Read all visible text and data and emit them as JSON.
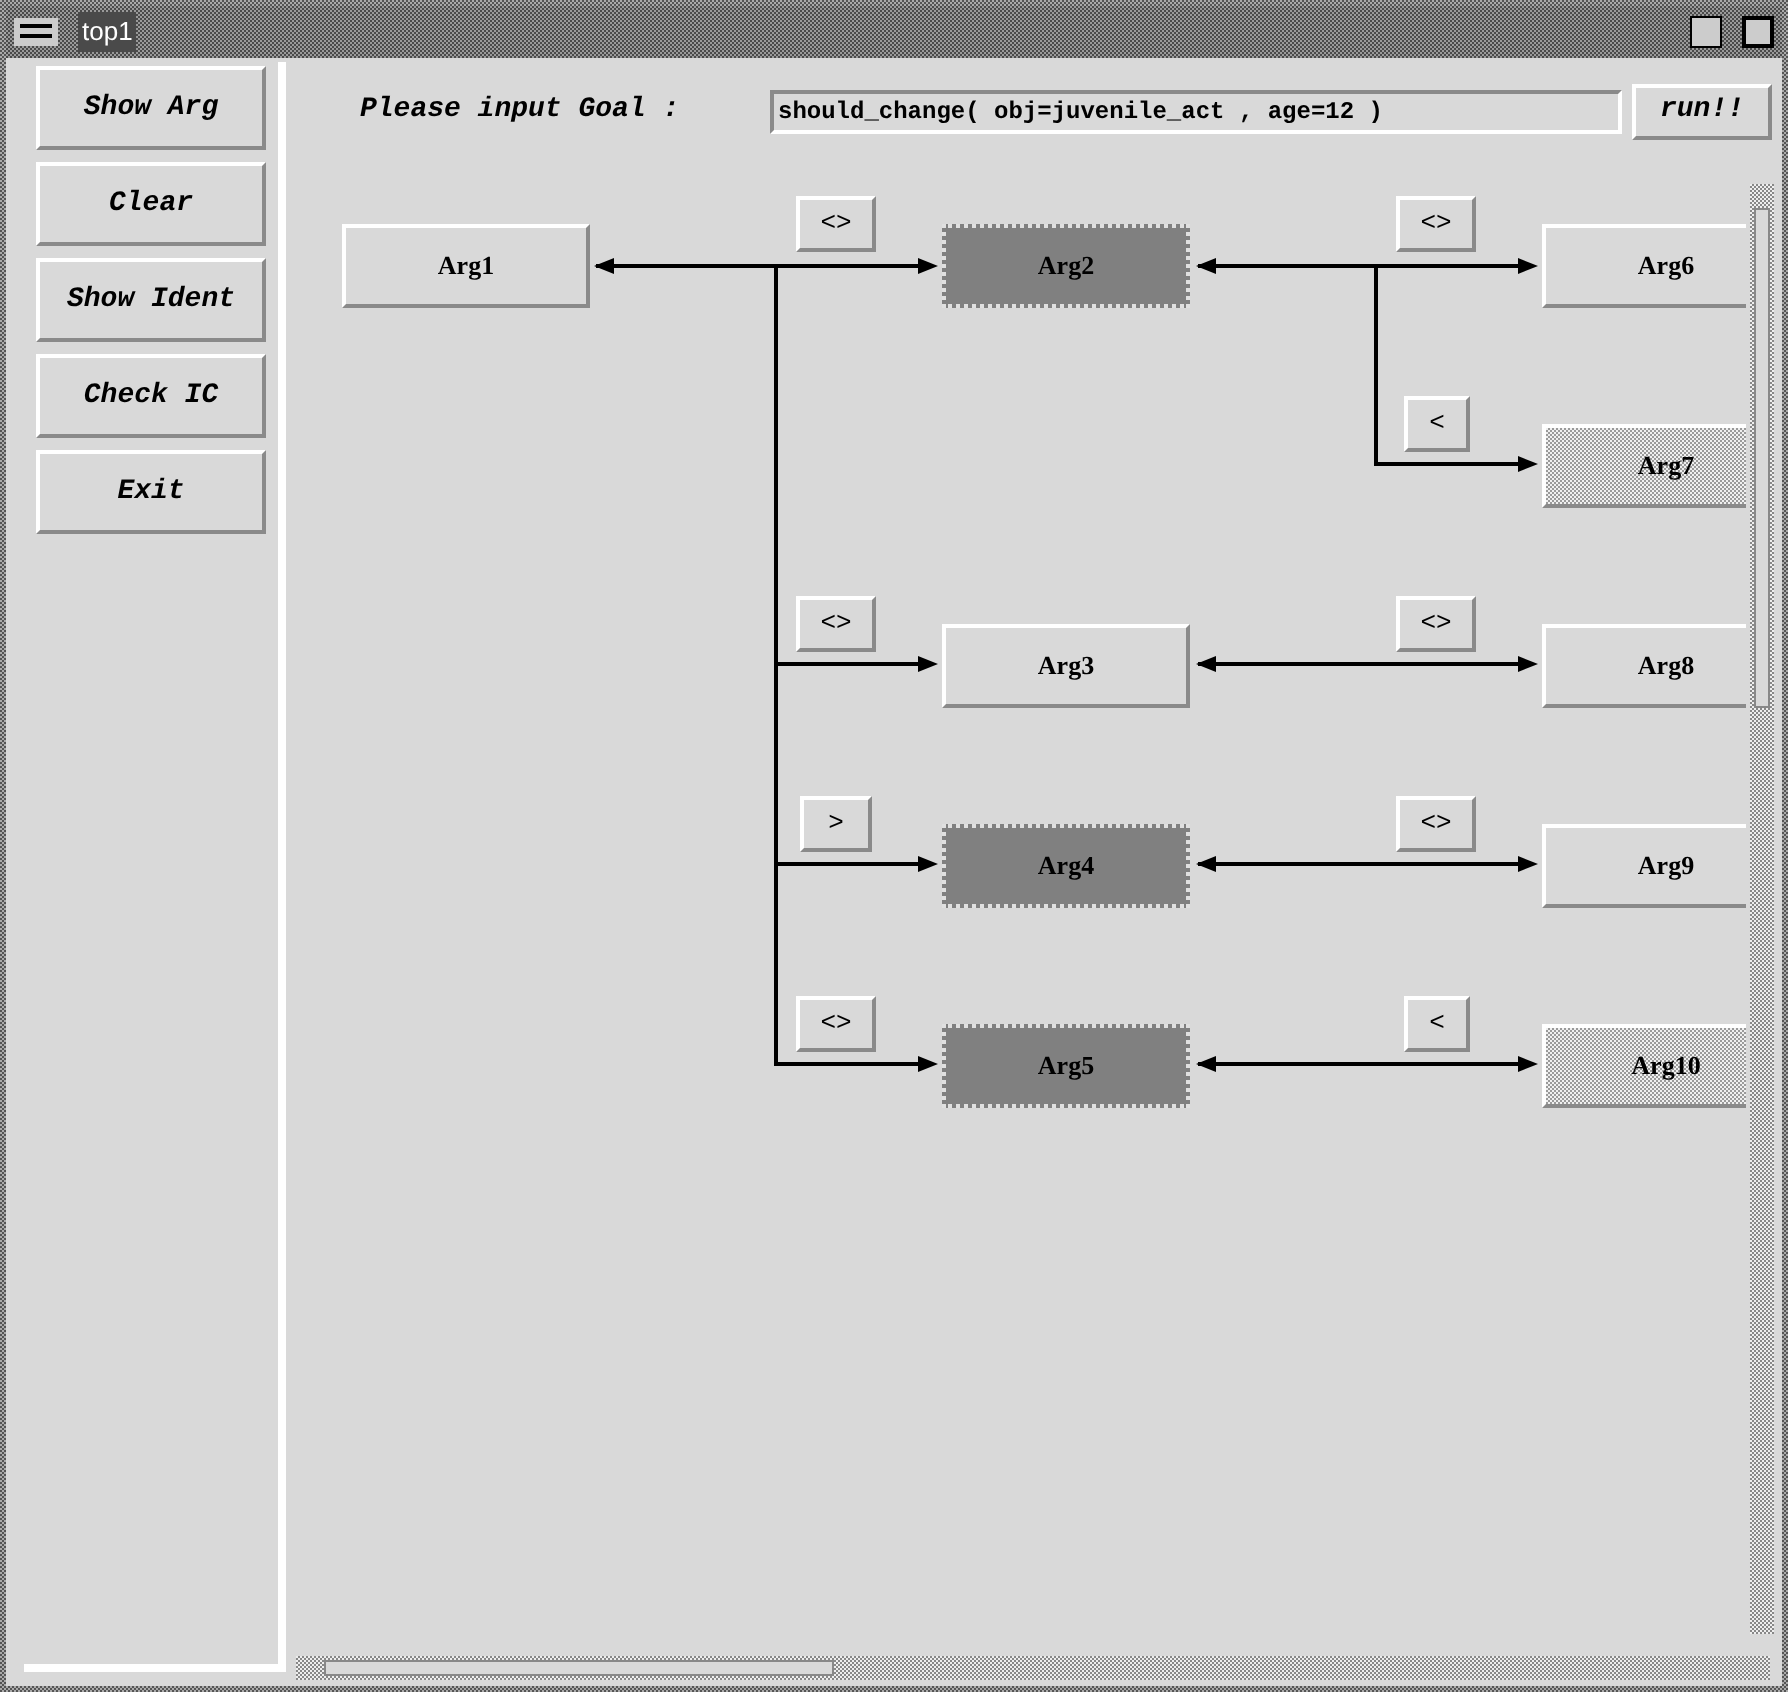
{
  "window": {
    "title": "top1"
  },
  "sidebar": {
    "buttons": [
      "Show Arg",
      "Clear",
      "Show Ident",
      "Check IC",
      "Exit"
    ]
  },
  "goal": {
    "label": "Please input Goal :",
    "value": "should_change( obj=juvenile_act , age=12 )",
    "run_button": "run!!"
  },
  "diagram": {
    "nodes": [
      {
        "label": "Arg1",
        "kind": "plain"
      },
      {
        "label": "Arg2",
        "kind": "dark"
      },
      {
        "label": "Arg6",
        "kind": "plain"
      },
      {
        "label": "Arg7",
        "kind": "stippled"
      },
      {
        "label": "Arg3",
        "kind": "plain"
      },
      {
        "label": "Arg8",
        "kind": "plain"
      },
      {
        "label": "Arg4",
        "kind": "dark"
      },
      {
        "label": "Arg9",
        "kind": "plain"
      },
      {
        "label": "Arg5",
        "kind": "dark"
      },
      {
        "label": "Arg10",
        "kind": "stippled"
      }
    ],
    "relation_buttons": [
      {
        "label": "<>"
      },
      {
        "label": "<>"
      },
      {
        "label": "<"
      },
      {
        "label": "<>"
      },
      {
        "label": "<>"
      },
      {
        "label": ">"
      },
      {
        "label": "<>"
      },
      {
        "label": "<>"
      },
      {
        "label": "<"
      }
    ]
  }
}
